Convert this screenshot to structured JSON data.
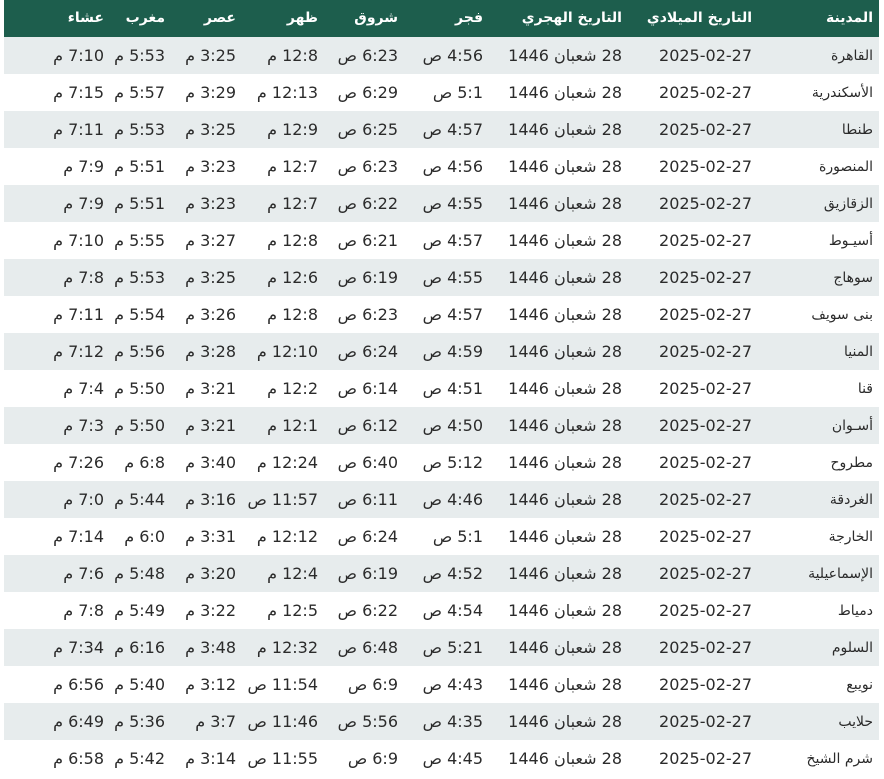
{
  "table": {
    "columns": [
      "المدينة",
      "التاريخ الميلادي",
      "التاريخ الهجري",
      "فجر",
      "شروق",
      "ظهر",
      "عصر",
      "مغرب",
      "عشاء"
    ],
    "rows": [
      [
        "القاهرة",
        "2025-02-27",
        "28 شعبان 1446",
        "4:56 ص",
        "6:23 ص",
        "12:8 م",
        "3:25 م",
        "5:53 م",
        "7:10 م"
      ],
      [
        "الأسكندرية",
        "2025-02-27",
        "28 شعبان 1446",
        "5:1 ص",
        "6:29 ص",
        "12:13 م",
        "3:29 م",
        "5:57 م",
        "7:15 م"
      ],
      [
        "طنطا",
        "2025-02-27",
        "28 شعبان 1446",
        "4:57 ص",
        "6:25 ص",
        "12:9 م",
        "3:25 م",
        "5:53 م",
        "7:11 م"
      ],
      [
        "المنصورة",
        "2025-02-27",
        "28 شعبان 1446",
        "4:56 ص",
        "6:23 ص",
        "12:7 م",
        "3:23 م",
        "5:51 م",
        "7:9 م"
      ],
      [
        "الزقازيق",
        "2025-02-27",
        "28 شعبان 1446",
        "4:55 ص",
        "6:22 ص",
        "12:7 م",
        "3:23 م",
        "5:51 م",
        "7:9 م"
      ],
      [
        "أسيـوط",
        "2025-02-27",
        "28 شعبان 1446",
        "4:57 ص",
        "6:21 ص",
        "12:8 م",
        "3:27 م",
        "5:55 م",
        "7:10 م"
      ],
      [
        "سوهاج",
        "2025-02-27",
        "28 شعبان 1446",
        "4:55 ص",
        "6:19 ص",
        "12:6 م",
        "3:25 م",
        "5:53 م",
        "7:8 م"
      ],
      [
        "بنى سويف",
        "2025-02-27",
        "28 شعبان 1446",
        "4:57 ص",
        "6:23 ص",
        "12:8 م",
        "3:26 م",
        "5:54 م",
        "7:11 م"
      ],
      [
        "المنيا",
        "2025-02-27",
        "28 شعبان 1446",
        "4:59 ص",
        "6:24 ص",
        "12:10 م",
        "3:28 م",
        "5:56 م",
        "7:12 م"
      ],
      [
        "قنا",
        "2025-02-27",
        "28 شعبان 1446",
        "4:51 ص",
        "6:14 ص",
        "12:2 م",
        "3:21 م",
        "5:50 م",
        "7:4 م"
      ],
      [
        "أسـوان",
        "2025-02-27",
        "28 شعبان 1446",
        "4:50 ص",
        "6:12 ص",
        "12:1 م",
        "3:21 م",
        "5:50 م",
        "7:3 م"
      ],
      [
        "مطروح",
        "2025-02-27",
        "28 شعبان 1446",
        "5:12 ص",
        "6:40 ص",
        "12:24 م",
        "3:40 م",
        "6:8 م",
        "7:26 م"
      ],
      [
        "الغردقة",
        "2025-02-27",
        "28 شعبان 1446",
        "4:46 ص",
        "6:11 ص",
        "11:57 ص",
        "3:16 م",
        "5:44 م",
        "7:0 م"
      ],
      [
        "الخارجة",
        "2025-02-27",
        "28 شعبان 1446",
        "5:1 ص",
        "6:24 ص",
        "12:12 م",
        "3:31 م",
        "6:0 م",
        "7:14 م"
      ],
      [
        "الإسماعيلية",
        "2025-02-27",
        "28 شعبان 1446",
        "4:52 ص",
        "6:19 ص",
        "12:4 م",
        "3:20 م",
        "5:48 م",
        "7:6 م"
      ],
      [
        "دمياط",
        "2025-02-27",
        "28 شعبان 1446",
        "4:54 ص",
        "6:22 ص",
        "12:5 م",
        "3:22 م",
        "5:49 م",
        "7:8 م"
      ],
      [
        "السلوم",
        "2025-02-27",
        "28 شعبان 1446",
        "5:21 ص",
        "6:48 ص",
        "12:32 م",
        "3:48 م",
        "6:16 م",
        "7:34 م"
      ],
      [
        "نويبع",
        "2025-02-27",
        "28 شعبان 1446",
        "4:43 ص",
        "6:9 ص",
        "11:54 ص",
        "3:12 م",
        "5:40 م",
        "6:56 م"
      ],
      [
        "حلايب",
        "2025-02-27",
        "28 شعبان 1446",
        "4:35 ص",
        "5:56 ص",
        "11:46 ص",
        "3:7 م",
        "5:36 م",
        "6:49 م"
      ],
      [
        "شرم الشيخ",
        "2025-02-27",
        "28 شعبان 1446",
        "4:45 ص",
        "6:9 ص",
        "11:55 ص",
        "3:14 م",
        "5:42 م",
        "6:58 م"
      ]
    ]
  }
}
